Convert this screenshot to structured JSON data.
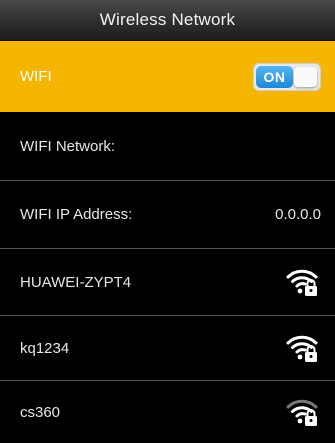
{
  "header": {
    "title": "Wireless Network"
  },
  "wifi": {
    "label": "WIFI",
    "toggle_state": "ON",
    "toggle_on": true
  },
  "rows": [
    {
      "label": "WIFI Network:",
      "value": ""
    },
    {
      "label": "WIFI IP Address:",
      "value": "0.0.0.0"
    }
  ],
  "networks": [
    {
      "ssid": "HUAWEI-ZYPT4",
      "icon": "wifi-locked-icon",
      "signal": "strong"
    },
    {
      "ssid": "kq1234",
      "icon": "wifi-locked-icon",
      "signal": "strong"
    },
    {
      "ssid": "cs360",
      "icon": "wifi-locked-icon",
      "signal": "medium"
    }
  ],
  "colors": {
    "accent": "#f5b500",
    "toggle_blue": "#1f86d6",
    "background": "#000000"
  }
}
